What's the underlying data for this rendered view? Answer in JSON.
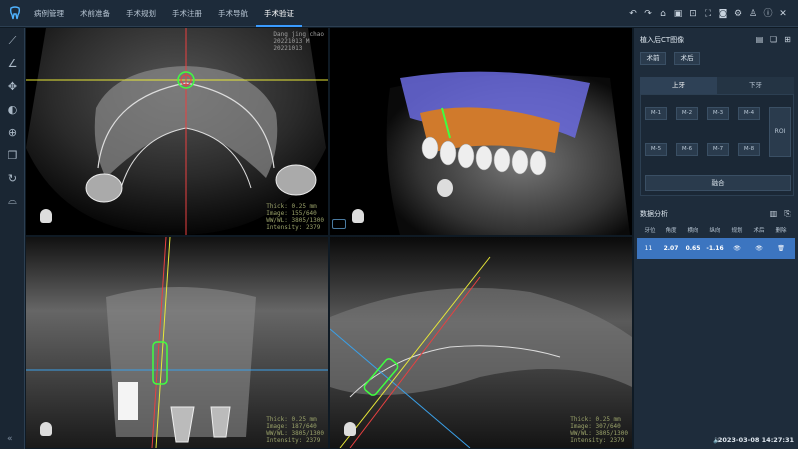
{
  "app": {
    "logo_icon": "tooth-icon",
    "nav": [
      {
        "label": "病例管理"
      },
      {
        "label": "术前准备"
      },
      {
        "label": "手术规划"
      },
      {
        "label": "手术注册"
      },
      {
        "label": "手术导航"
      },
      {
        "label": "手术验证",
        "active": true
      }
    ],
    "toolbar_icons": [
      "undo-icon",
      "redo-icon",
      "home-icon",
      "save-icon",
      "fit-icon",
      "fullscreen-icon",
      "screenshot-icon",
      "settings-icon",
      "user-icon",
      "info-icon",
      "close-icon"
    ]
  },
  "left_tools": [
    "ruler-icon",
    "angle-icon",
    "pan-icon",
    "contrast-icon",
    "zoom-icon",
    "layers-icon",
    "reset-icon",
    "panorama-icon"
  ],
  "viewports": {
    "axial": {
      "patient_name": "Dang jing chao",
      "patient_id": "20221013 M",
      "study_date": "20221013",
      "info": "Thick: 0.25 mm\nImage: 155/640\nWW/WL: 3805/1300\nIntensity: 2379"
    },
    "sagittal": {
      "info": "Thick: 0.25 mm\nImage: 187/640\nWW/WL: 3805/1300\nIntensity: 2379"
    },
    "coronal": {
      "info": "Thick: 0.25 mm\nImage: 307/640\nWW/WL: 3805/1300\nIntensity: 2379"
    }
  },
  "panel": {
    "postop_ct_title": "植入后CT图像",
    "btn_preop": "术前",
    "btn_postop": "术后",
    "tab_upper": "上牙",
    "tab_lower": "下牙",
    "markers": [
      "M-1",
      "M-2",
      "M-3",
      "M-4",
      "M-5",
      "M-6",
      "M-7",
      "M-8"
    ],
    "roi_label": "ROI",
    "fuse_label": "融合",
    "analysis_title": "数据分析",
    "columns": [
      "牙位",
      "角度",
      "横向",
      "纵向",
      "规划",
      "术后",
      "删除"
    ],
    "rows": [
      {
        "tooth": "11",
        "angle": "2.07",
        "horizontal": "0.65",
        "vertical": "-1.16"
      }
    ]
  },
  "status": {
    "datetime": "2023-03-08 14:27:31"
  },
  "colors": {
    "accent": "#3a9bff",
    "selected_row": "#3c75c0",
    "crosshair_yellow": "#e8e838",
    "crosshair_red": "#e84040",
    "crosshair_blue": "#3aa0e8"
  }
}
